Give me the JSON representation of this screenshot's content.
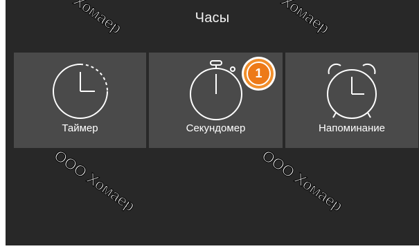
{
  "header": {
    "title": "Часы"
  },
  "tiles": [
    {
      "label": "Таймер",
      "icon": "timer-icon"
    },
    {
      "label": "Секундомер",
      "icon": "stopwatch-icon",
      "badge": "1"
    },
    {
      "label": "Напоминание",
      "icon": "alarm-clock-icon"
    }
  ],
  "watermarks": [
    "Хомаер",
    "Хомаер",
    "ООО Хомаер",
    "ООО Хомаер"
  ],
  "colors": {
    "background": "#282828",
    "tile": "#4a4a4a",
    "badge": "#ed7a18",
    "text": "#ffffff"
  }
}
